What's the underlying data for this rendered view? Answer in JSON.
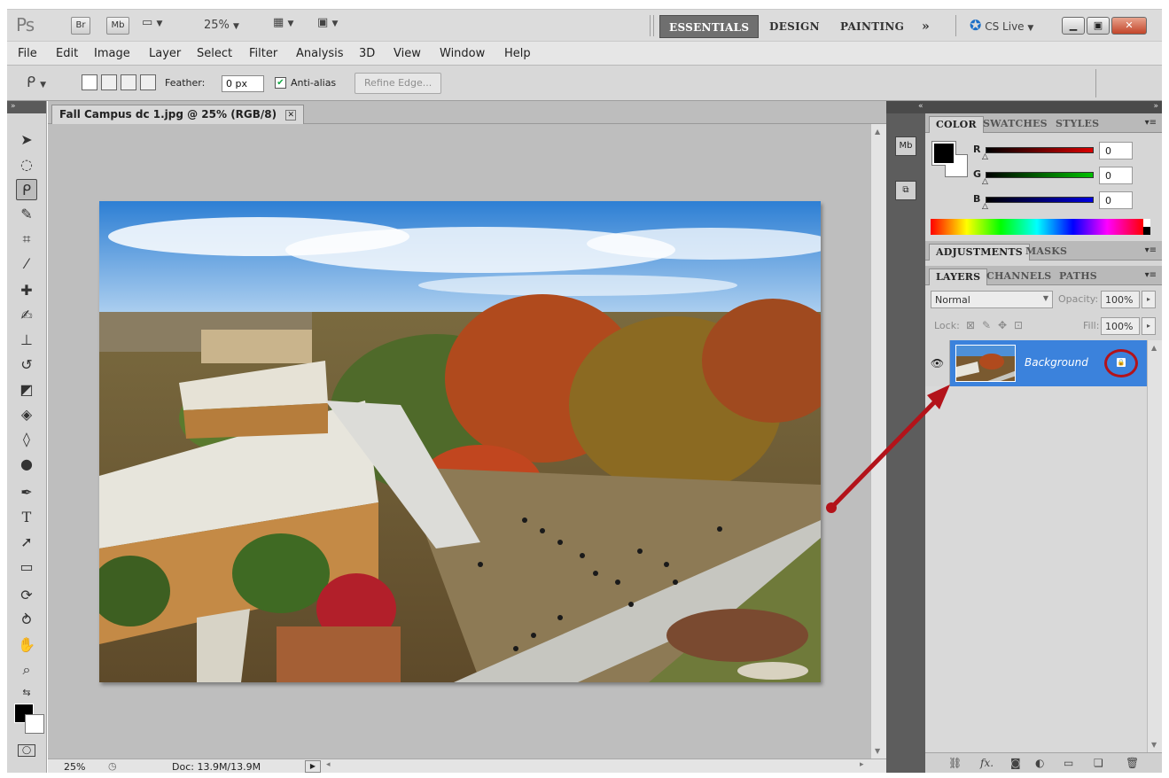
{
  "app": {
    "logo": "Ps",
    "bridge_btn": "Br",
    "minibridge_btn": "Mb",
    "zoom_level": "25%",
    "workspaces": [
      "ESSENTIALS",
      "DESIGN",
      "PAINTING"
    ],
    "more_workspaces": "»",
    "cs_live": "CS Live"
  },
  "menu": [
    "File",
    "Edit",
    "Image",
    "Layer",
    "Select",
    "Filter",
    "Analysis",
    "3D",
    "View",
    "Window",
    "Help"
  ],
  "options": {
    "feather_label": "Feather:",
    "feather_value": "0 px",
    "antialias_label": "Anti-alias",
    "antialias_checked": true,
    "refine_edge": "Refine Edge..."
  },
  "document": {
    "tab_title": "Fall Campus dc 1.jpg @ 25% (RGB/8)",
    "zoom": "25%",
    "doc_info": "Doc: 13.9M/13.9M"
  },
  "color_panel": {
    "tabs": [
      "COLOR",
      "SWATCHES",
      "STYLES"
    ],
    "channels": [
      {
        "label": "R",
        "value": "0",
        "color": "#d90000"
      },
      {
        "label": "G",
        "value": "0",
        "color": "#00c000"
      },
      {
        "label": "B",
        "value": "0",
        "color": "#0000e0"
      }
    ]
  },
  "adjust_panel": {
    "tabs": [
      "ADJUSTMENTS",
      "MASKS"
    ]
  },
  "layers_panel": {
    "tabs": [
      "LAYERS",
      "CHANNELS",
      "PATHS"
    ],
    "blend_mode": "Normal",
    "opacity_label": "Opacity:",
    "opacity": "100%",
    "lock_label": "Lock:",
    "fill_label": "Fill:",
    "fill": "100%",
    "layers": [
      {
        "name": "Background",
        "locked": true,
        "visible": true
      }
    ]
  },
  "colors": {
    "selected_layer": "#3b82dc",
    "annotation_red": "#b3131a",
    "active_workspace": "#6f6f6f"
  }
}
